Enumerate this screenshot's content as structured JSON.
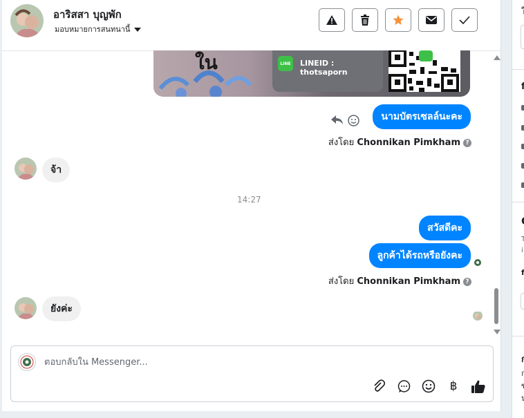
{
  "header": {
    "contact_name": "อาริสสา บุญพัก",
    "assign_label": "มอบหมายการสนทนานี้",
    "buttons": [
      "spam-warning",
      "delete",
      "star",
      "mark-unread",
      "mark-done"
    ]
  },
  "messages": {
    "image_card_text": "LINEID : thotsaporn",
    "image_card_logo": "LINE",
    "image_card_overlay": "ใน",
    "out_1": "นามบัตรเซลล์นะคะ",
    "sent_by_1_prefix": "ส่งโดย",
    "sent_by_1_name": "Chonnikan Pimkham",
    "in_1": "จ้า",
    "timestamp": "14:27",
    "out_2": "สวัสดีคะ",
    "out_3": "ลูกค้าได้รถหรือยังคะ",
    "sent_by_2_prefix": "ส่งโดย",
    "sent_by_2_name": "Chonnikan Pimkham",
    "in_2": "ยังค่ะ",
    "help_glyph": "?"
  },
  "composer": {
    "placeholder": "ตอบกลับใน Messenger...",
    "tools": [
      "attach",
      "saved-reply",
      "emoji",
      "payment",
      "like"
    ],
    "payment_glyph": "฿"
  },
  "right_panel": {
    "chars": [
      "ใ",
      "f",
      "C",
      "T",
      "i",
      "f",
      "ก",
      "ก",
      "ข",
      "น"
    ]
  },
  "colors": {
    "accent": "#0084ff",
    "star": "#f7923a",
    "incoming_bubble": "#f0f0f0"
  }
}
